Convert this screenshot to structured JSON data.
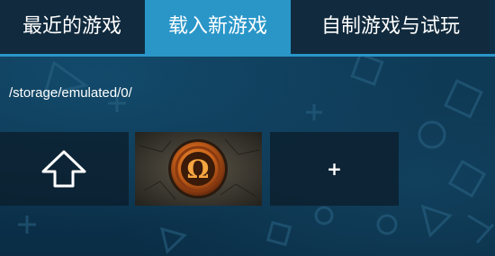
{
  "tabs": [
    {
      "label": "最近的游戏",
      "active": false
    },
    {
      "label": "载入新游戏",
      "active": true
    },
    {
      "label": "自制游戏与试玩",
      "active": false
    }
  ],
  "browser": {
    "path": "/storage/emulated/0/",
    "items": [
      {
        "type": "parent-directory",
        "icon": "up-arrow-icon"
      },
      {
        "type": "game",
        "icon": "omega-emblem-icon"
      },
      {
        "type": "add",
        "label": "+"
      }
    ]
  },
  "colors": {
    "accent": "#2a96c8",
    "tab_background": "#112a3d",
    "background": "#0c3550"
  }
}
